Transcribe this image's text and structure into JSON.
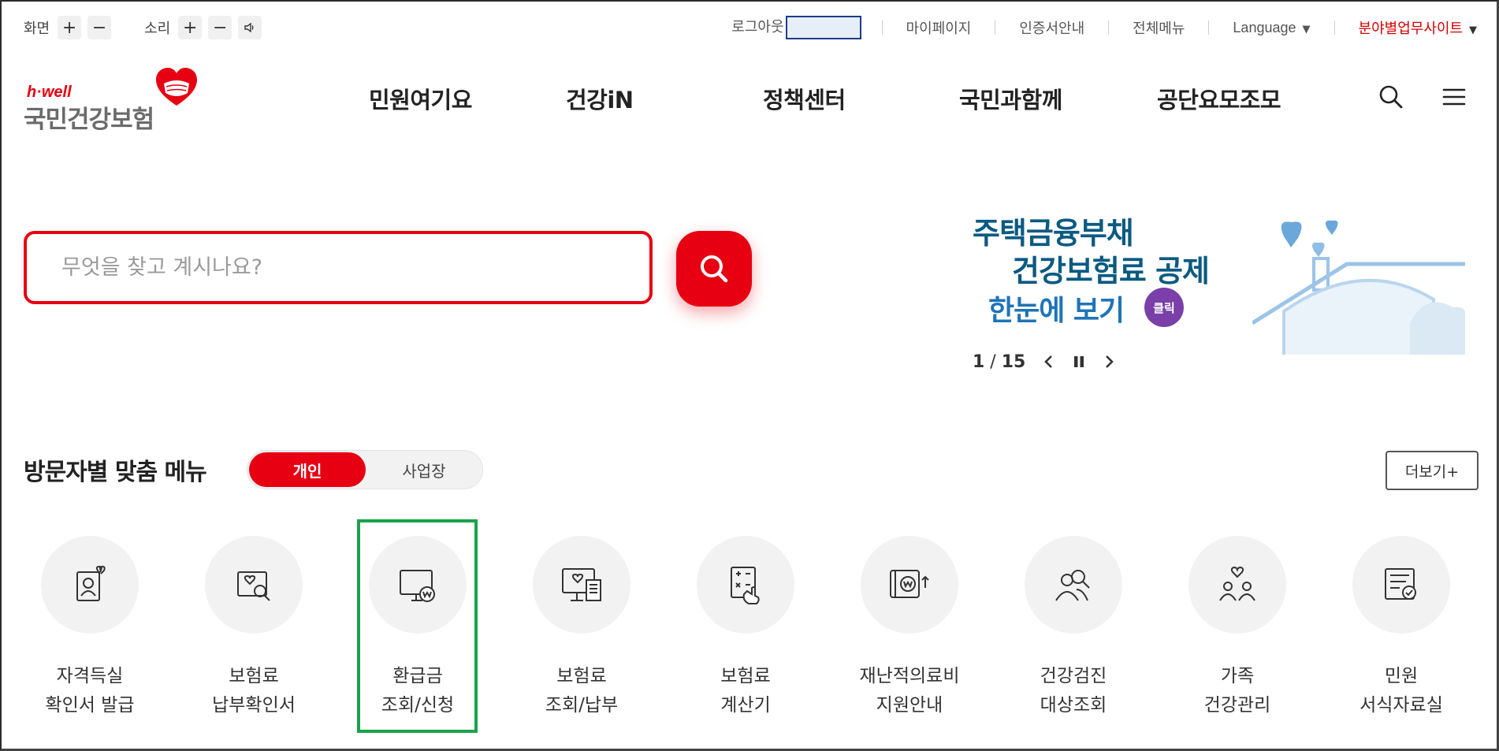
{
  "utility": {
    "screen_label": "화면",
    "sound_label": "소리",
    "plus": "+",
    "minus": "−"
  },
  "top_links": {
    "logout": "로그아웃",
    "mypage": "마이페이지",
    "cert": "인증서안내",
    "allmenu": "전체메뉴",
    "language": "Language",
    "field_sites": "분야별업무사이트"
  },
  "logo": {
    "hwell": "h·well",
    "name": "국민건강보험"
  },
  "gnb": [
    "민원여기요",
    "건강iN",
    "정책센터",
    "국민과함께",
    "공단요모조모"
  ],
  "search": {
    "placeholder": "무엇을 찾고 계시나요?"
  },
  "banner": {
    "line1": "주택금융부채",
    "line2": "건강보험료 공제",
    "line3": "한눈에 보기",
    "click": "클릭",
    "current": "1",
    "slash": " / ",
    "total": "15"
  },
  "visitor_menu": {
    "title": "방문자별 맞춤 메뉴",
    "tab_personal": "개인",
    "tab_business": "사업장",
    "more": "더보기+",
    "items": [
      {
        "line1": "자격득실",
        "line2": "확인서 발급",
        "icon": "person-card-heart-icon"
      },
      {
        "line1": "보험료",
        "line2": "납부확인서",
        "icon": "document-search-icon"
      },
      {
        "line1": "환급금",
        "line2": "조회/신청",
        "icon": "monitor-won-icon"
      },
      {
        "line1": "보험료",
        "line2": "조회/납부",
        "icon": "monitor-receipt-icon"
      },
      {
        "line1": "보험료",
        "line2": "계산기",
        "icon": "calculator-hand-icon"
      },
      {
        "line1": "재난적의료비",
        "line2": "지원안내",
        "icon": "wallet-won-icon"
      },
      {
        "line1": "건강검진",
        "line2": "대상조회",
        "icon": "people-search-icon"
      },
      {
        "line1": "가족",
        "line2": "건강관리",
        "icon": "family-heart-icon"
      },
      {
        "line1": "민원",
        "line2": "서식자료실",
        "icon": "form-check-icon"
      }
    ]
  },
  "colors": {
    "brand_red": "#e60012",
    "highlight_green": "#18a34a",
    "banner_blue": "#0b5a82"
  }
}
